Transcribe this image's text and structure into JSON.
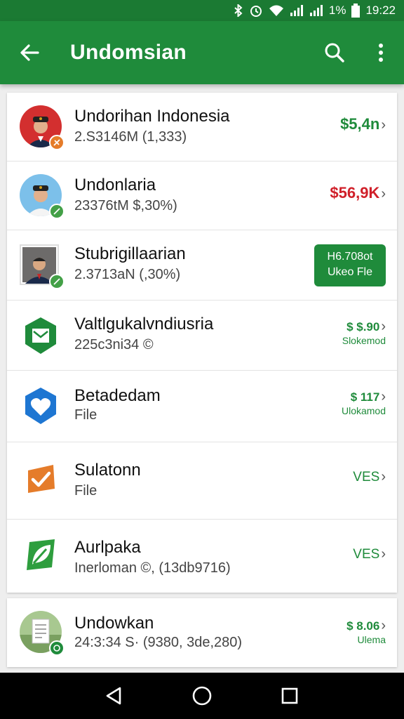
{
  "status_bar": {
    "battery": "1%",
    "time": "19:22"
  },
  "app_bar": {
    "title": "Undomsian"
  },
  "items": [
    {
      "name": "Undorihan Indonesia",
      "detail": "2.S3146M (1,333)",
      "amount": "$5,4n",
      "amount_color": "#1f8b3b"
    },
    {
      "name": "Undonlaria",
      "detail": "23376tM $,30%)",
      "amount": "$56,9K",
      "amount_color": "#d0202a"
    },
    {
      "name": "Stubrigillaarian",
      "detail": "2.3713aN (,30%)",
      "pill_top": "H6.708ot",
      "pill_bottom": "Ukeo Fle"
    },
    {
      "name": "Valtlgukalvndiusria",
      "detail": "225c3ni34 ©",
      "amount": "$ $.90",
      "sub": "Slokemod"
    },
    {
      "name": "Betadedam",
      "detail": "File",
      "amount": "$ 117",
      "sub": "Ulokamod"
    },
    {
      "name": "Sulatonn",
      "detail": "File",
      "amount": "VES"
    },
    {
      "name": "Aurlpaka",
      "detail": "Inerloman ©, (13db9716)",
      "amount": "VES"
    }
  ],
  "footer_item": {
    "name": "Undowkan",
    "detail": "24:3:34 S· (9380, 3de,280)",
    "amount": "$ 8.06",
    "sub": "Ulema"
  },
  "colors": {
    "primary": "#1f8b3b",
    "status_bar": "#1b7a33",
    "negative": "#d0202a"
  }
}
